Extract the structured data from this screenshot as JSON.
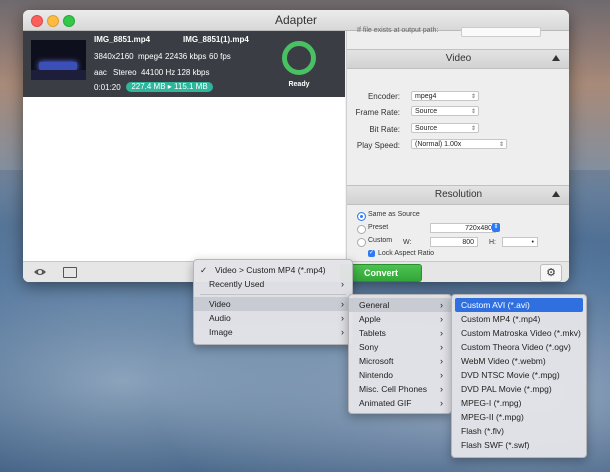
{
  "window": {
    "title": "Adapter"
  },
  "file": {
    "name_in": "IMG_8851.mp4",
    "name_out": "IMG_8851(1).mp4",
    "resolution": "3840x2160",
    "codec": "mpeg4",
    "bitrate": "22436 kbps",
    "fps": "60 fps",
    "audio_codec": "aac",
    "channels": "Stereo",
    "sample_rate": "44100 Hz",
    "audio_bitrate": "128 kbps",
    "duration": "0:01:20",
    "size_change": "227.4 MB ▸ 115.1 MB",
    "status": "Ready"
  },
  "toolbar": {
    "convert_label": "Convert",
    "gear_icon": "gear-icon",
    "preview_icon": "eye-icon",
    "log_icon": "monitor-icon"
  },
  "settings": {
    "cut_text": "If file exists at output path:",
    "video": {
      "title": "Video",
      "encoder_label": "Encoder:",
      "encoder_value": "mpeg4",
      "framerate_label": "Frame Rate:",
      "framerate_value": "Source",
      "bitrate_label": "Bit Rate:",
      "bitrate_value": "Source",
      "playspeed_label": "Play Speed:",
      "playspeed_value": "(Normal) 1.00x"
    },
    "resolution": {
      "title": "Resolution",
      "same_as_source": "Same as Source",
      "preset": "Preset",
      "preset_value": "720x480",
      "custom": "Custom",
      "w_label": "W:",
      "w_value": "800",
      "h_label": "H:",
      "h_value": "",
      "lock_aspect": "Lock Aspect Ratio"
    }
  },
  "menu_main": {
    "items": [
      {
        "label": "Video > Custom MP4 (*.mp4)",
        "checked": true
      },
      {
        "label": "Recently Used"
      },
      {
        "label": "Video"
      },
      {
        "label": "Audio"
      },
      {
        "label": "Image"
      }
    ]
  },
  "menu_categories": {
    "items": [
      "General",
      "Apple",
      "Tablets",
      "Sony",
      "Microsoft",
      "Nintendo",
      "Misc. Cell Phones",
      "Animated GIF"
    ]
  },
  "menu_formats": {
    "items": [
      "Custom AVI (*.avi)",
      "Custom MP4 (*.mp4)",
      "Custom Matroska Video (*.mkv)",
      "Custom Theora Video (*.ogv)",
      "WebM Video (*.webm)",
      "DVD NTSC Movie (*.mpg)",
      "DVD PAL Movie (*.mpg)",
      "MPEG-I (*.mpg)",
      "MPEG-II (*.mpg)",
      "Flash (*.flv)",
      "Flash SWF (*.swf)"
    ]
  }
}
